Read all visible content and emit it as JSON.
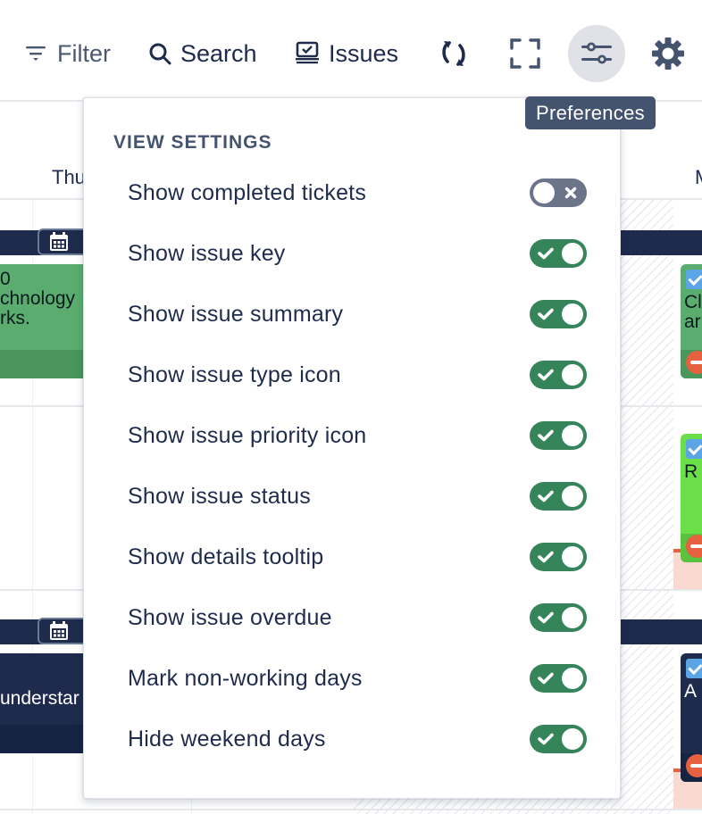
{
  "toolbar": {
    "filter_label": "Filter",
    "search_label": "Search",
    "issues_label": "Issues",
    "icons": {
      "filter": "filter-icon",
      "search": "search-icon",
      "issues": "issues-icon",
      "refresh": "refresh-icon",
      "fullscreen": "fullscreen-icon",
      "preferences": "preferences-sliders-icon",
      "settings": "gear-icon"
    }
  },
  "tooltip": {
    "text": "Preferences"
  },
  "calendar": {
    "day_labels": [
      "Thu",
      "M"
    ],
    "cards": [
      {
        "text": "0\nchnology\nrks.",
        "color": "#5aad6e"
      },
      {
        "text": "understar",
        "color": "#1e2b4c"
      },
      {
        "text": "Cl\nar",
        "color": "#5aad6e"
      },
      {
        "text": "R",
        "color": "#6adf48"
      },
      {
        "text": "A",
        "color": "#1e2b4c"
      }
    ]
  },
  "preferences": {
    "section_title": "VIEW SETTINGS",
    "settings": [
      {
        "label": "Show completed tickets",
        "enabled": false
      },
      {
        "label": "Show issue key",
        "enabled": true
      },
      {
        "label": "Show issue summary",
        "enabled": true
      },
      {
        "label": "Show issue type icon",
        "enabled": true
      },
      {
        "label": "Show issue priority icon",
        "enabled": true
      },
      {
        "label": "Show issue status",
        "enabled": true
      },
      {
        "label": "Show details tooltip",
        "enabled": true
      },
      {
        "label": "Show issue overdue",
        "enabled": true
      },
      {
        "label": "Mark non-working days",
        "enabled": true
      },
      {
        "label": "Hide weekend days",
        "enabled": true
      }
    ]
  },
  "colors": {
    "toggle_on": "#36845a",
    "toggle_off": "#6b7488",
    "navy": "#1e2b4c",
    "tooltip_bg": "#44546f"
  }
}
